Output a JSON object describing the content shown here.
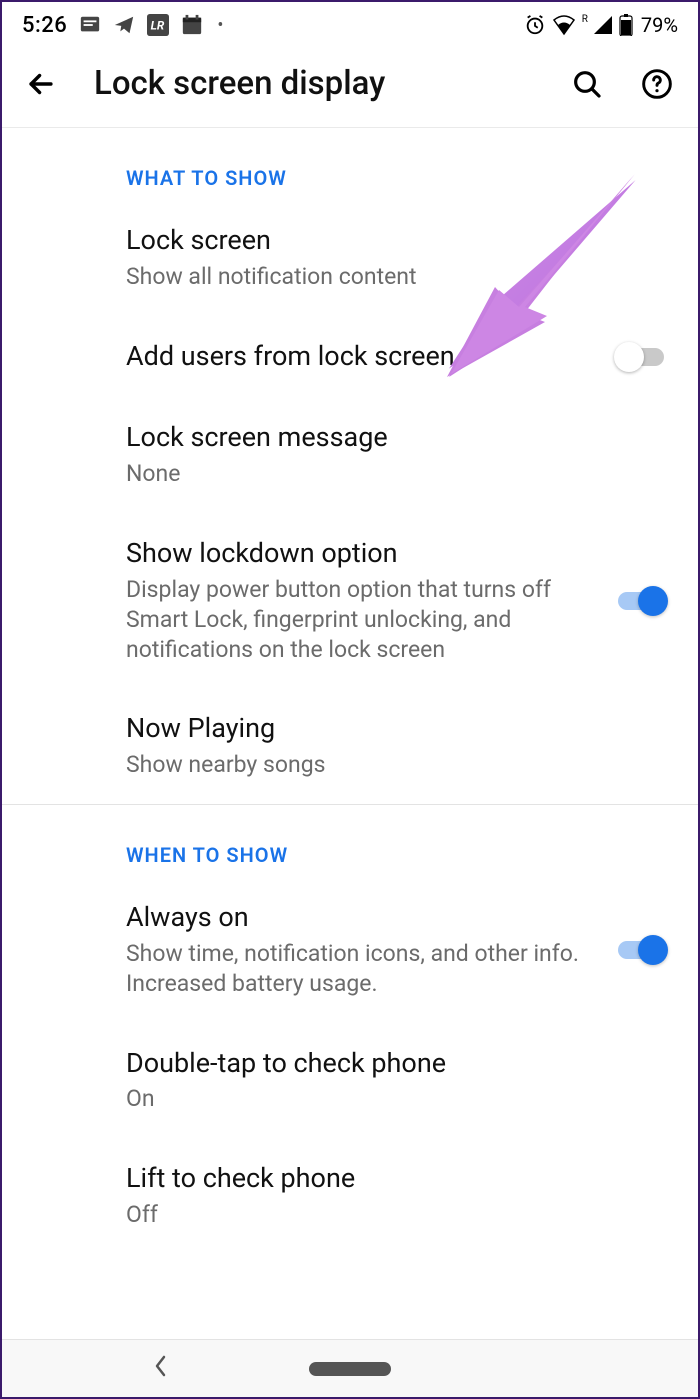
{
  "status": {
    "time": "5:26",
    "battery": "79%"
  },
  "app_bar": {
    "title": "Lock screen display"
  },
  "sections": [
    {
      "header": "WHAT TO SHOW",
      "rows": {
        "lock_screen": {
          "title": "Lock screen",
          "subtitle": "Show all notification content"
        },
        "add_users": {
          "title": "Add users from lock screen"
        },
        "lock_msg": {
          "title": "Lock screen message",
          "subtitle": "None"
        },
        "lockdown": {
          "title": "Show lockdown option",
          "subtitle": "Display power button option that turns off Smart Lock, fingerprint unlocking, and notifications on the lock screen"
        },
        "now_playing": {
          "title": "Now Playing",
          "subtitle": "Show nearby songs"
        }
      }
    },
    {
      "header": "WHEN TO SHOW",
      "rows": {
        "always_on": {
          "title": "Always on",
          "subtitle": "Show time, notification icons, and other info. Increased battery usage."
        },
        "double_tap": {
          "title": "Double-tap to check phone",
          "subtitle": "On"
        },
        "lift": {
          "title": "Lift to check phone",
          "subtitle": "Off"
        }
      }
    }
  ],
  "toggles": {
    "add_users": false,
    "lockdown": true,
    "always_on": true
  }
}
